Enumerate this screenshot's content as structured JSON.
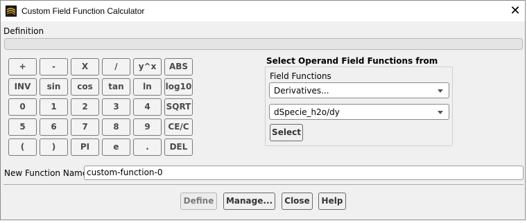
{
  "window": {
    "title": "Custom Field Function Calculator",
    "close_label": "✕"
  },
  "definition": {
    "label": "Definition",
    "value": ""
  },
  "calculator": {
    "rows": [
      [
        "+",
        "-",
        "X",
        "/",
        "y^x",
        "ABS"
      ],
      [
        "INV",
        "sin",
        "cos",
        "tan",
        "ln",
        "log10"
      ],
      [
        "0",
        "1",
        "2",
        "3",
        "4",
        "SQRT"
      ],
      [
        "5",
        "6",
        "7",
        "8",
        "9",
        "CE/C"
      ],
      [
        "(",
        ")",
        "PI",
        "e",
        ".",
        "DEL"
      ]
    ]
  },
  "operands": {
    "title": "Select Operand Field Functions from",
    "field_functions_label": "Field Functions",
    "category_selected": "Derivatives...",
    "function_selected": "dSpecie_h2o/dy",
    "select_label": "Select"
  },
  "new_function": {
    "label": "New Function Name",
    "value": "custom-function-0"
  },
  "footer": {
    "define": "Define",
    "manage": "Manage...",
    "close": "Close",
    "help": "Help"
  }
}
